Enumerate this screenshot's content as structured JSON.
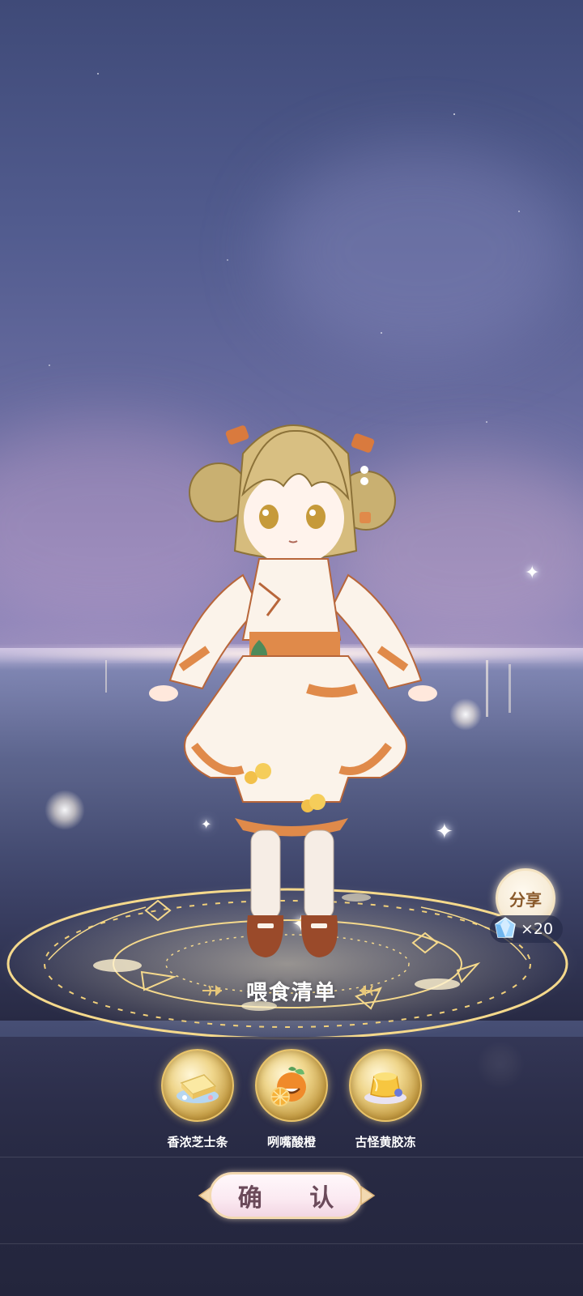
{
  "share": {
    "label": "分享",
    "reward_count": "×20",
    "reward_icon": "crystal-gem-icon"
  },
  "feed_list": {
    "title": "喂食清单",
    "items": [
      {
        "name": "香浓芝士条",
        "icon": "cheese-stick-icon"
      },
      {
        "name": "咧嘴酸橙",
        "icon": "grinning-orange-icon"
      },
      {
        "name": "古怪黄胶冻",
        "icon": "yellow-jelly-pudding-icon"
      }
    ]
  },
  "confirm": {
    "label": "确 认"
  },
  "colors": {
    "gold": "#e8c36a",
    "panel": "#2d2f4d",
    "button_text": "#6b4a5a"
  }
}
